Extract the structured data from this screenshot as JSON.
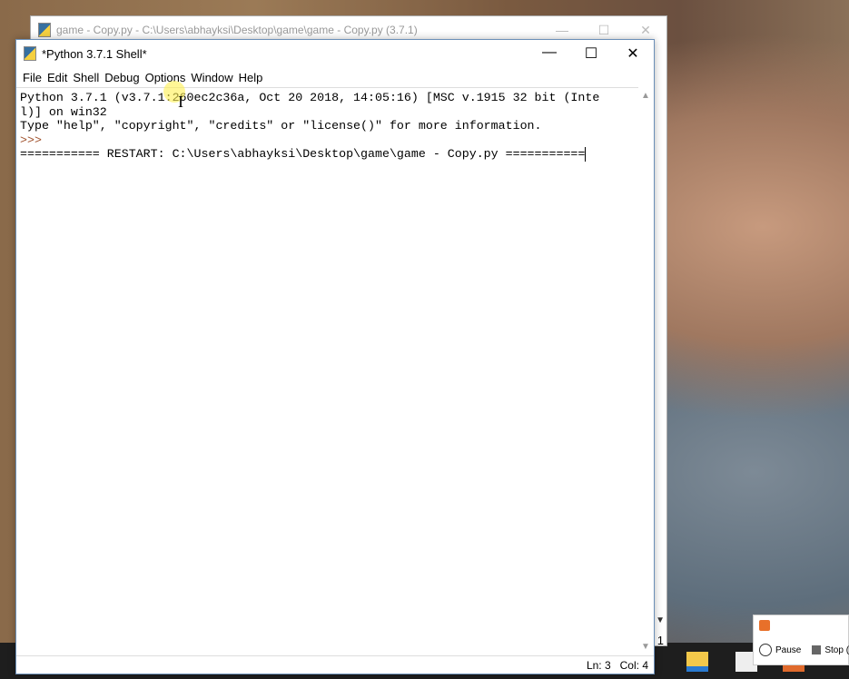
{
  "back_window": {
    "title": "game - Copy.py - C:\\Users\\abhayksi\\Desktop\\game\\game - Copy.py (3.7.1)",
    "line_fragment": "1"
  },
  "shell": {
    "title": "*Python 3.7.1 Shell*",
    "menu": [
      "File",
      "Edit",
      "Shell",
      "Debug",
      "Options",
      "Window",
      "Help"
    ],
    "lines": [
      "Python 3.7.1 (v3.7.1:260ec2c36a, Oct 20 2018, 14:05:16) [MSC v.1915 32 bit (Inte",
      "l)] on win32",
      "Type \"help\", \"copyright\", \"credits\" or \"license()\" for more information."
    ],
    "prompt": ">>> ",
    "restart": "=========== RESTART: C:\\Users\\abhayksi\\Desktop\\game\\game - Copy.py ===========",
    "status": {
      "ln": "Ln: 3",
      "col": "Col: 4"
    }
  },
  "recorder": {
    "pause": "Pause",
    "stop": "Stop (F"
  }
}
